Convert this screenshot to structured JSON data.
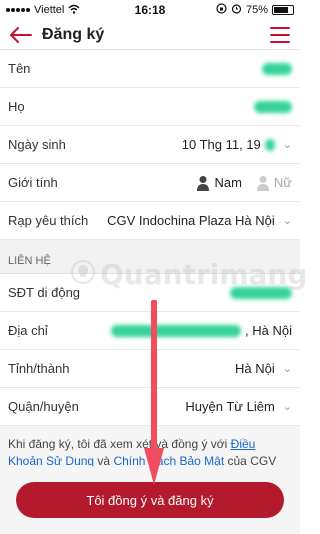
{
  "status_bar": {
    "carrier": "Viettel",
    "time": "16:18",
    "battery": "75%"
  },
  "header": {
    "title": "Đăng ký",
    "back_icon": "arrow-left-icon",
    "menu_icon": "hamburger-menu-icon"
  },
  "form": {
    "ten_label": "Tên",
    "ho_label": "Họ",
    "dob_label": "Ngày sinh",
    "dob_value": "10 Thg 11, 19",
    "gender_label": "Giới tính",
    "gender_male": "Nam",
    "gender_female": "Nữ",
    "favorite_theater_label": "Rạp yêu thích",
    "favorite_theater_value": "CGV Indochina Plaza Hà Nội",
    "contact_section": "LIÊN HỆ",
    "phone_label": "SĐT di động",
    "address_label": "Địa chỉ",
    "address_suffix": ", Hà Nội",
    "province_label": "Tỉnh/thành",
    "province_value": "Hà Nội",
    "district_label": "Quận/huyện",
    "district_value": "Huyện Từ Liêm"
  },
  "terms": {
    "prefix": "Khi đăng ký, tôi đã xem xét và đồng ý với ",
    "terms_link": "Điều Khoản Sử Dụng",
    "and": " và ",
    "privacy_link": "Chính Sách Bảo Mật",
    "suffix": " của CGV Việt Nam."
  },
  "submit_button": "Tôi đồng ý và đăng ký",
  "watermark": "Quantrimang",
  "colors": {
    "accent": "#c8102e",
    "button": "#b31b2c",
    "link": "#1a66cc",
    "blur": "#34d39a",
    "arrow": "#f04e5e"
  }
}
